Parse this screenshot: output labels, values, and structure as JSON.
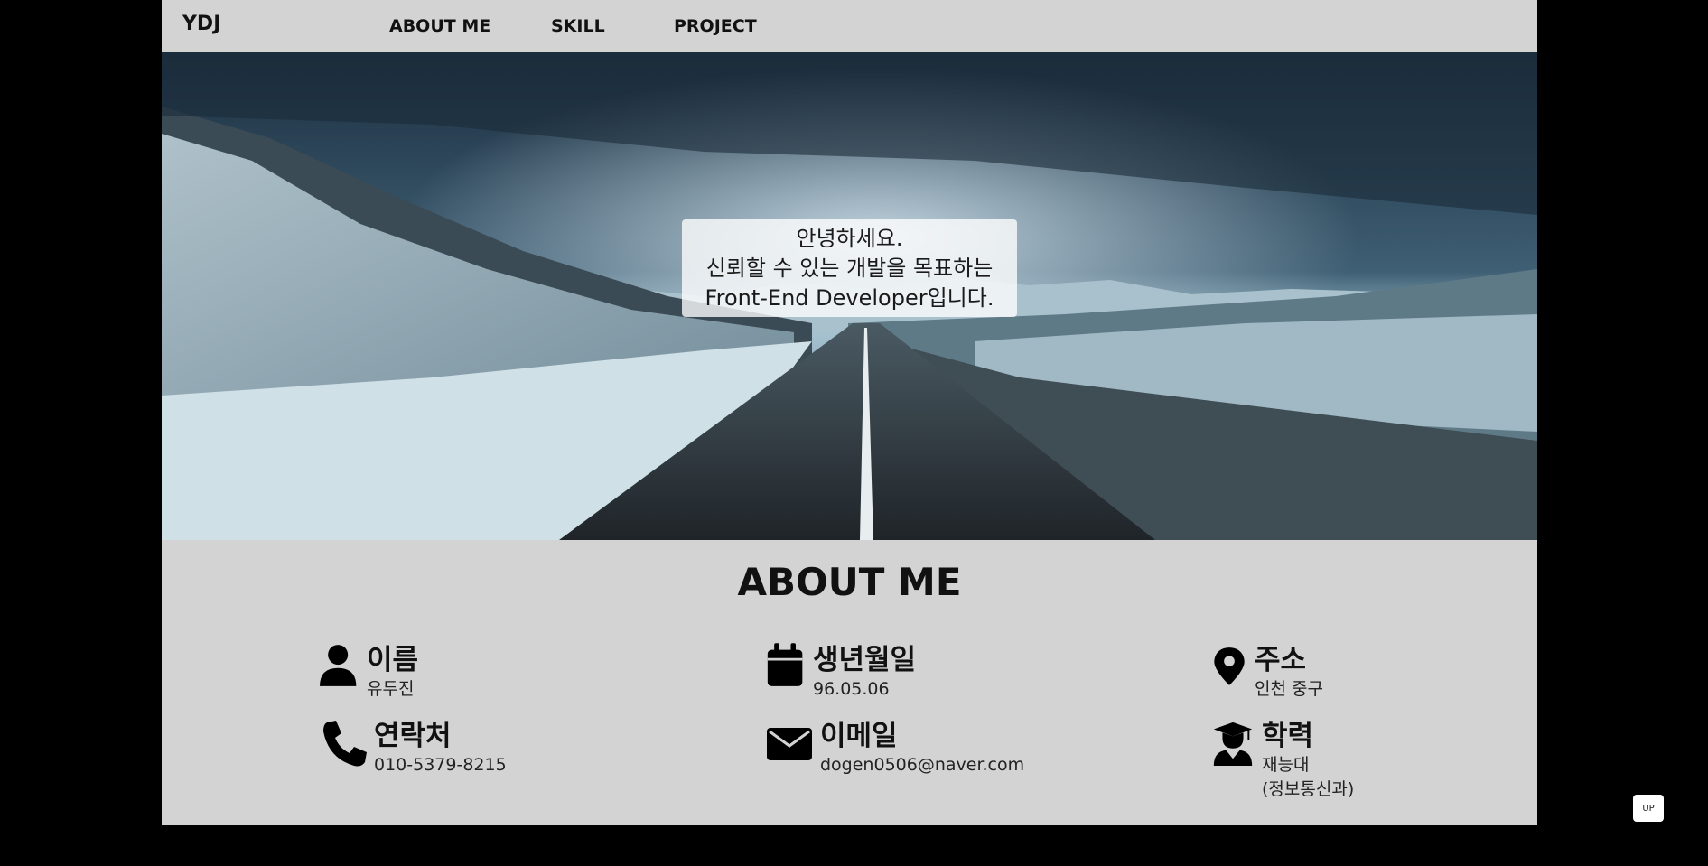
{
  "header": {
    "logo": "YDJ",
    "menu": [
      "ABOUT ME",
      "SKILL",
      "PROJECT"
    ]
  },
  "hero": {
    "lines": [
      "안녕하세요.",
      "신뢰할 수 있는 개발을 목표하는",
      "Front-End Developer입니다."
    ]
  },
  "about": {
    "title": "ABOUT ME",
    "items": [
      {
        "icon": "person-icon",
        "title": "이름",
        "value": "유두진"
      },
      {
        "icon": "calendar-icon",
        "title": "생년월일",
        "value": "96.05.06"
      },
      {
        "icon": "map-pin-icon",
        "title": "주소",
        "value": "인천 중구"
      },
      {
        "icon": "phone-icon",
        "title": "연락처",
        "value": "010-5379-8215"
      },
      {
        "icon": "envelope-icon",
        "title": "이메일",
        "value": "dogen0506@naver.com"
      },
      {
        "icon": "graduate-icon",
        "title": "학력",
        "value": "재능대",
        "value2": "(정보통신과)"
      }
    ]
  },
  "up_button": "UP",
  "colors": {
    "page_bg": "#d3d3d3",
    "outer_bg": "#000000",
    "text": "#111111"
  }
}
